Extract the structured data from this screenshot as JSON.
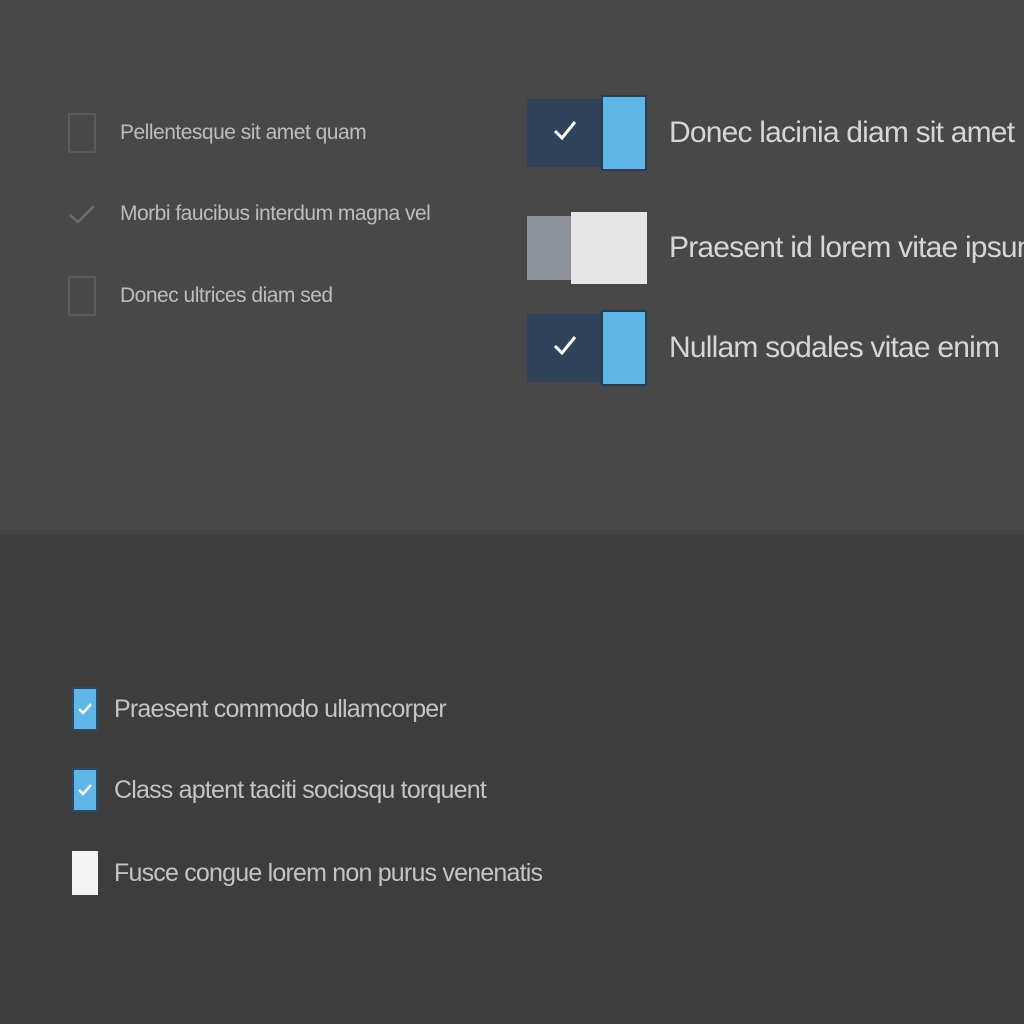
{
  "outline_list": {
    "items": [
      {
        "label": "Pellentesque sit amet quam",
        "state": "unchecked"
      },
      {
        "label": "Morbi faucibus interdum magna vel",
        "state": "checked"
      },
      {
        "label": "Donec ultrices diam sed",
        "state": "unchecked"
      }
    ]
  },
  "toggle_list": {
    "items": [
      {
        "label": "Donec lacinia diam sit amet",
        "state": "on"
      },
      {
        "label": "Praesent id lorem vitae ipsum",
        "state": "off"
      },
      {
        "label": "Nullam sodales vitae enim",
        "state": "on"
      }
    ]
  },
  "filled_list": {
    "items": [
      {
        "label": "Praesent commodo ullamcorper",
        "state": "checked"
      },
      {
        "label": "Class aptent taciti sociosqu torquent",
        "state": "checked"
      },
      {
        "label": "Fusce congue lorem non purus venenatis",
        "state": "unchecked"
      }
    ]
  },
  "colors": {
    "top_background": "#484848",
    "bottom_background": "#3d3d3d",
    "accent": "#5fb6e6",
    "toggle_track_on": "#31435a",
    "toggle_track_off": "#8c939b"
  },
  "icons": {
    "check": "check-icon"
  }
}
